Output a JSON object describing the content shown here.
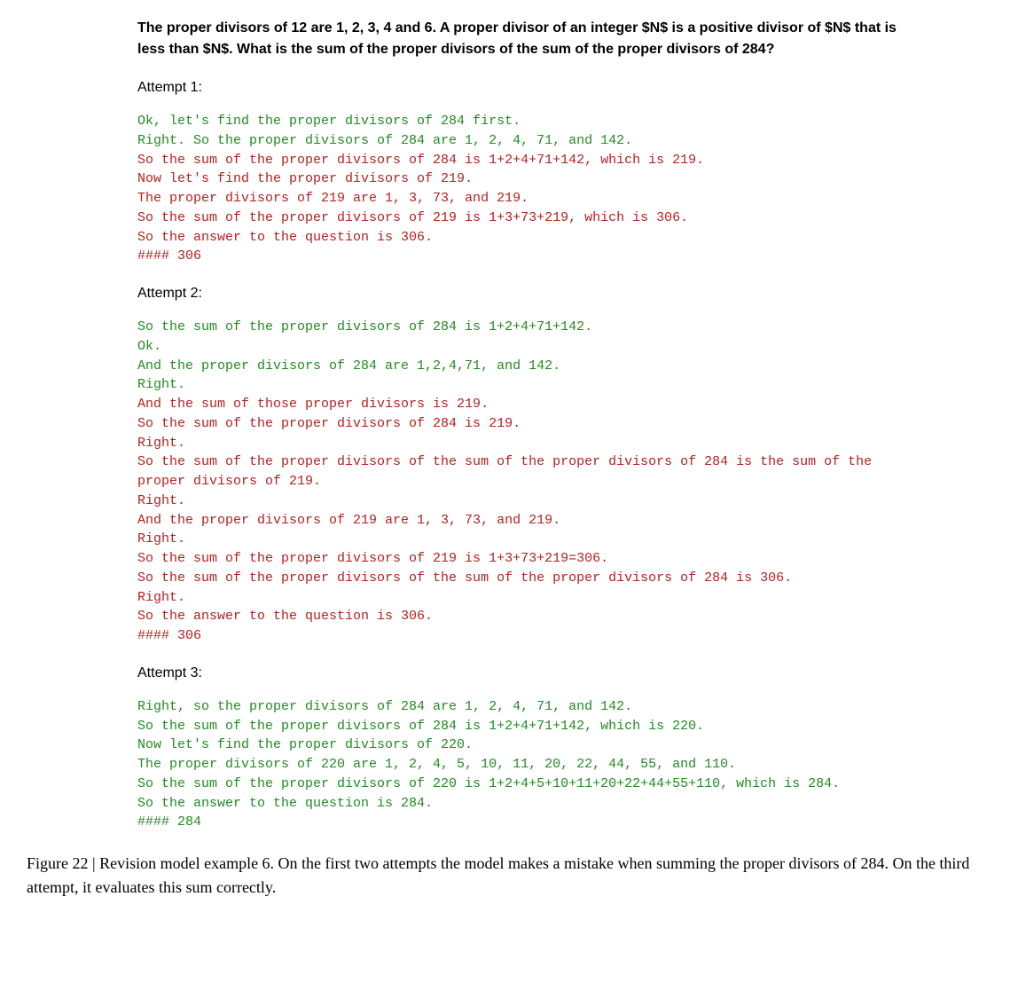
{
  "question": "The proper divisors of 12 are 1, 2, 3, 4 and 6. A proper divisor of an integer $N$ is a positive divisor of $N$ that is less than $N$. What is the sum of the proper divisors of the sum of the proper divisors of 284?",
  "attempt1_label": "Attempt 1:",
  "attempt1": {
    "lines": [
      {
        "cls": "green",
        "text": "Ok, let's find the proper divisors of 284 first."
      },
      {
        "cls": "green",
        "text": "Right. So the proper divisors of 284 are 1, 2, 4, 71, and 142."
      },
      {
        "cls": "red",
        "text": "So the sum of the proper divisors of 284 is 1+2+4+71+142, which is 219."
      },
      {
        "cls": "red",
        "text": "Now let's find the proper divisors of 219."
      },
      {
        "cls": "red",
        "text": "The proper divisors of 219 are 1, 3, 73, and 219."
      },
      {
        "cls": "red",
        "text": "So the sum of the proper divisors of 219 is 1+3+73+219, which is 306."
      },
      {
        "cls": "red",
        "text": "So the answer to the question is 306."
      },
      {
        "cls": "red",
        "text": "#### 306"
      }
    ]
  },
  "attempt2_label": "Attempt 2:",
  "attempt2": {
    "lines": [
      {
        "cls": "green",
        "text": "So the sum of the proper divisors of 284 is 1+2+4+71+142."
      },
      {
        "cls": "green",
        "text": "Ok."
      },
      {
        "cls": "green",
        "text": "And the proper divisors of 284 are 1,2,4,71, and 142."
      },
      {
        "cls": "green",
        "text": "Right."
      },
      {
        "cls": "red",
        "text": "And the sum of those proper divisors is 219."
      },
      {
        "cls": "red",
        "text": "So the sum of the proper divisors of 284 is 219."
      },
      {
        "cls": "red",
        "text": "Right."
      },
      {
        "cls": "red",
        "text": "So the sum of the proper divisors of the sum of the proper divisors of 284 is the sum of the proper divisors of 219."
      },
      {
        "cls": "red",
        "text": "Right."
      },
      {
        "cls": "red",
        "text": "And the proper divisors of 219 are 1, 3, 73, and 219."
      },
      {
        "cls": "red",
        "text": "Right."
      },
      {
        "cls": "red",
        "text": "So the sum of the proper divisors of 219 is 1+3+73+219=306."
      },
      {
        "cls": "red",
        "text": "So the sum of the proper divisors of the sum of the proper divisors of 284 is 306."
      },
      {
        "cls": "red",
        "text": "Right."
      },
      {
        "cls": "red",
        "text": "So the answer to the question is 306."
      },
      {
        "cls": "red",
        "text": "#### 306"
      }
    ]
  },
  "attempt3_label": "Attempt 3:",
  "attempt3": {
    "lines": [
      {
        "cls": "green",
        "text": "Right, so the proper divisors of 284 are 1, 2, 4, 71, and 142."
      },
      {
        "cls": "green",
        "text": "So the sum of the proper divisors of 284 is 1+2+4+71+142, which is 220."
      },
      {
        "cls": "green",
        "text": "Now let's find the proper divisors of 220."
      },
      {
        "cls": "green",
        "text": "The proper divisors of 220 are 1, 2, 4, 5, 10, 11, 20, 22, 44, 55, and 110."
      },
      {
        "cls": "green",
        "text": "So the sum of the proper divisors of 220 is 1+2+4+5+10+11+20+22+44+55+110, which is 284."
      },
      {
        "cls": "green",
        "text": "So the answer to the question is 284."
      },
      {
        "cls": "green",
        "text": "#### 284"
      }
    ]
  },
  "caption": "Figure 22 | Revision model example 6. On the first two attempts the model makes a mistake when summing the proper divisors of 284. On the third attempt, it evaluates this sum correctly."
}
